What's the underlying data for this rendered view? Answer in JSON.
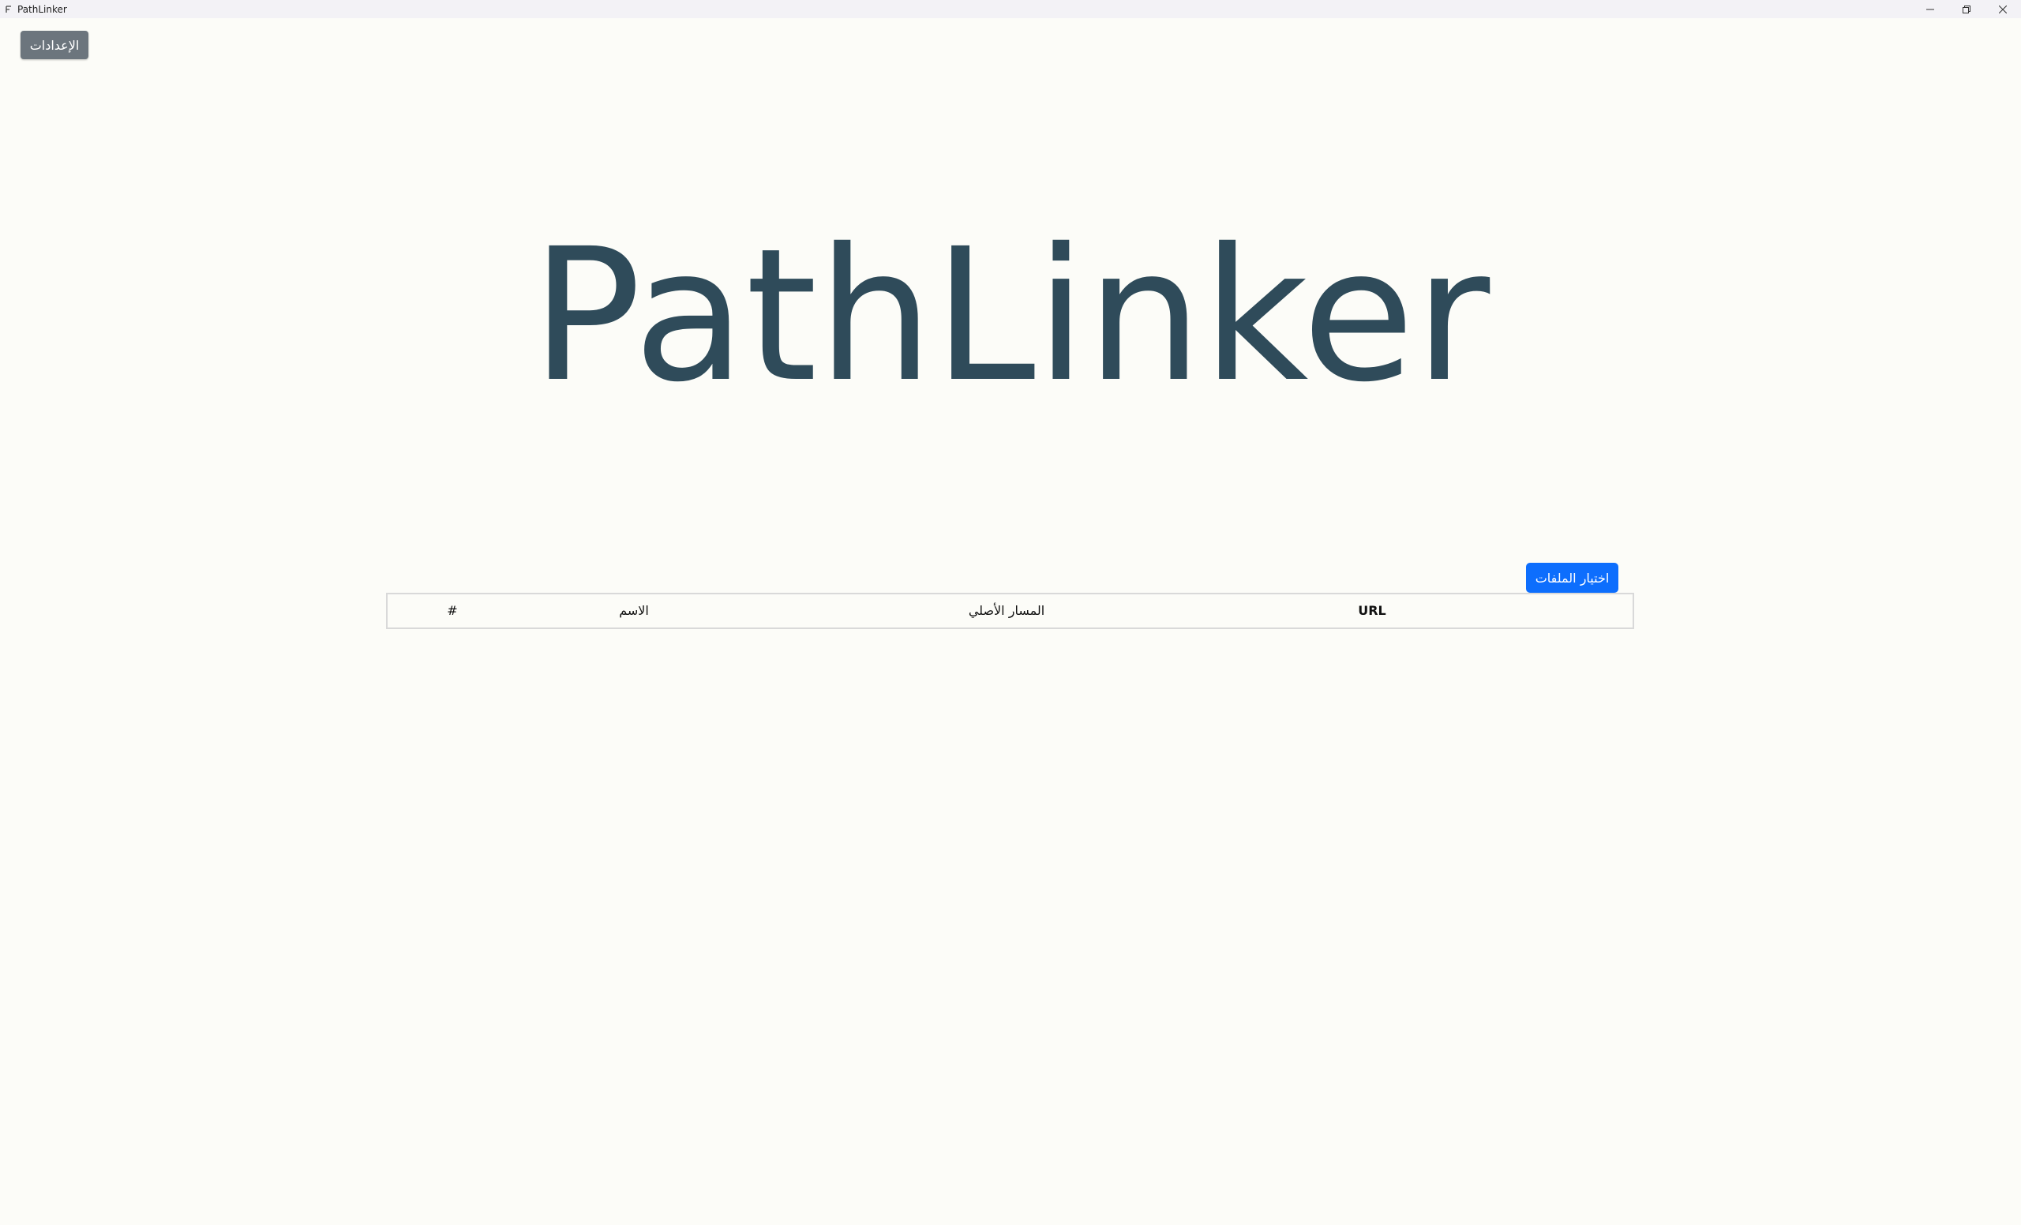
{
  "window": {
    "title": "PathLinker",
    "app_icon": "app-icon"
  },
  "toolbar": {
    "settings_label": "الإعدادات"
  },
  "main": {
    "logo_text": "PathLinker",
    "choose_files_label": "اختيار الملفات"
  },
  "table": {
    "columns": [
      "URL",
      "المسار الأصلي",
      "الاسم",
      "#"
    ]
  },
  "colors": {
    "background": "#fcfcf8",
    "logo": "#2f4b5a",
    "primary_button": "#0d6efd",
    "secondary_button": "#6c757d"
  }
}
